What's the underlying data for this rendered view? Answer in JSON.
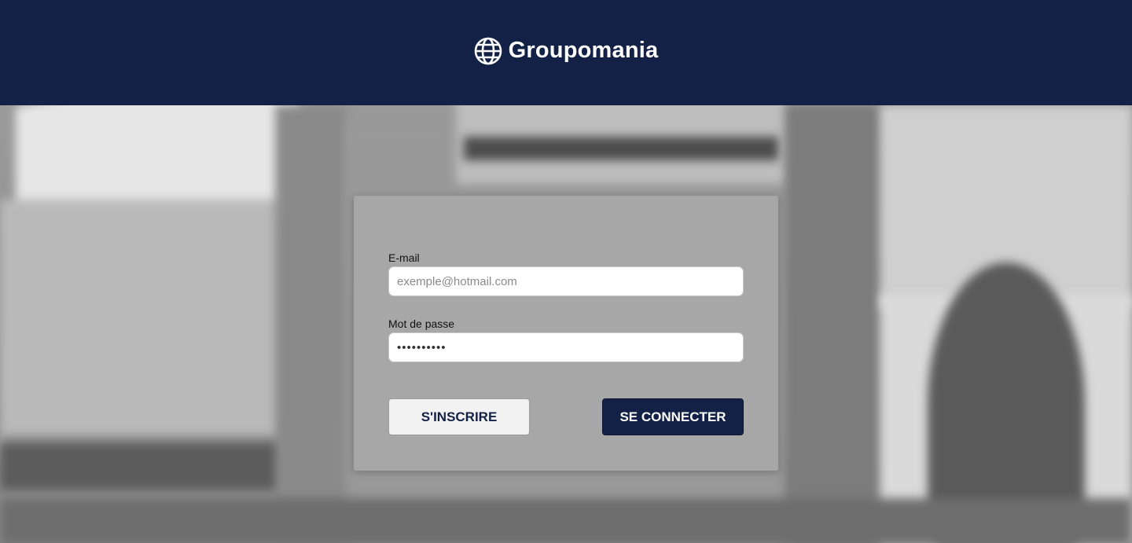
{
  "header": {
    "brand_name": "Groupomania",
    "brand_icon": "globe-icon",
    "background_color": "#132146"
  },
  "login_form": {
    "email_label": "E-mail",
    "email_placeholder": "exemple@hotmail.com",
    "email_value": "",
    "password_label": "Mot de passe",
    "password_value": "••••••••••",
    "signup_button_label": "S'INSCRIRE",
    "login_button_label": "SE CONNECTER"
  },
  "colors": {
    "primary": "#132146",
    "secondary_button": "#f2f2f2"
  }
}
